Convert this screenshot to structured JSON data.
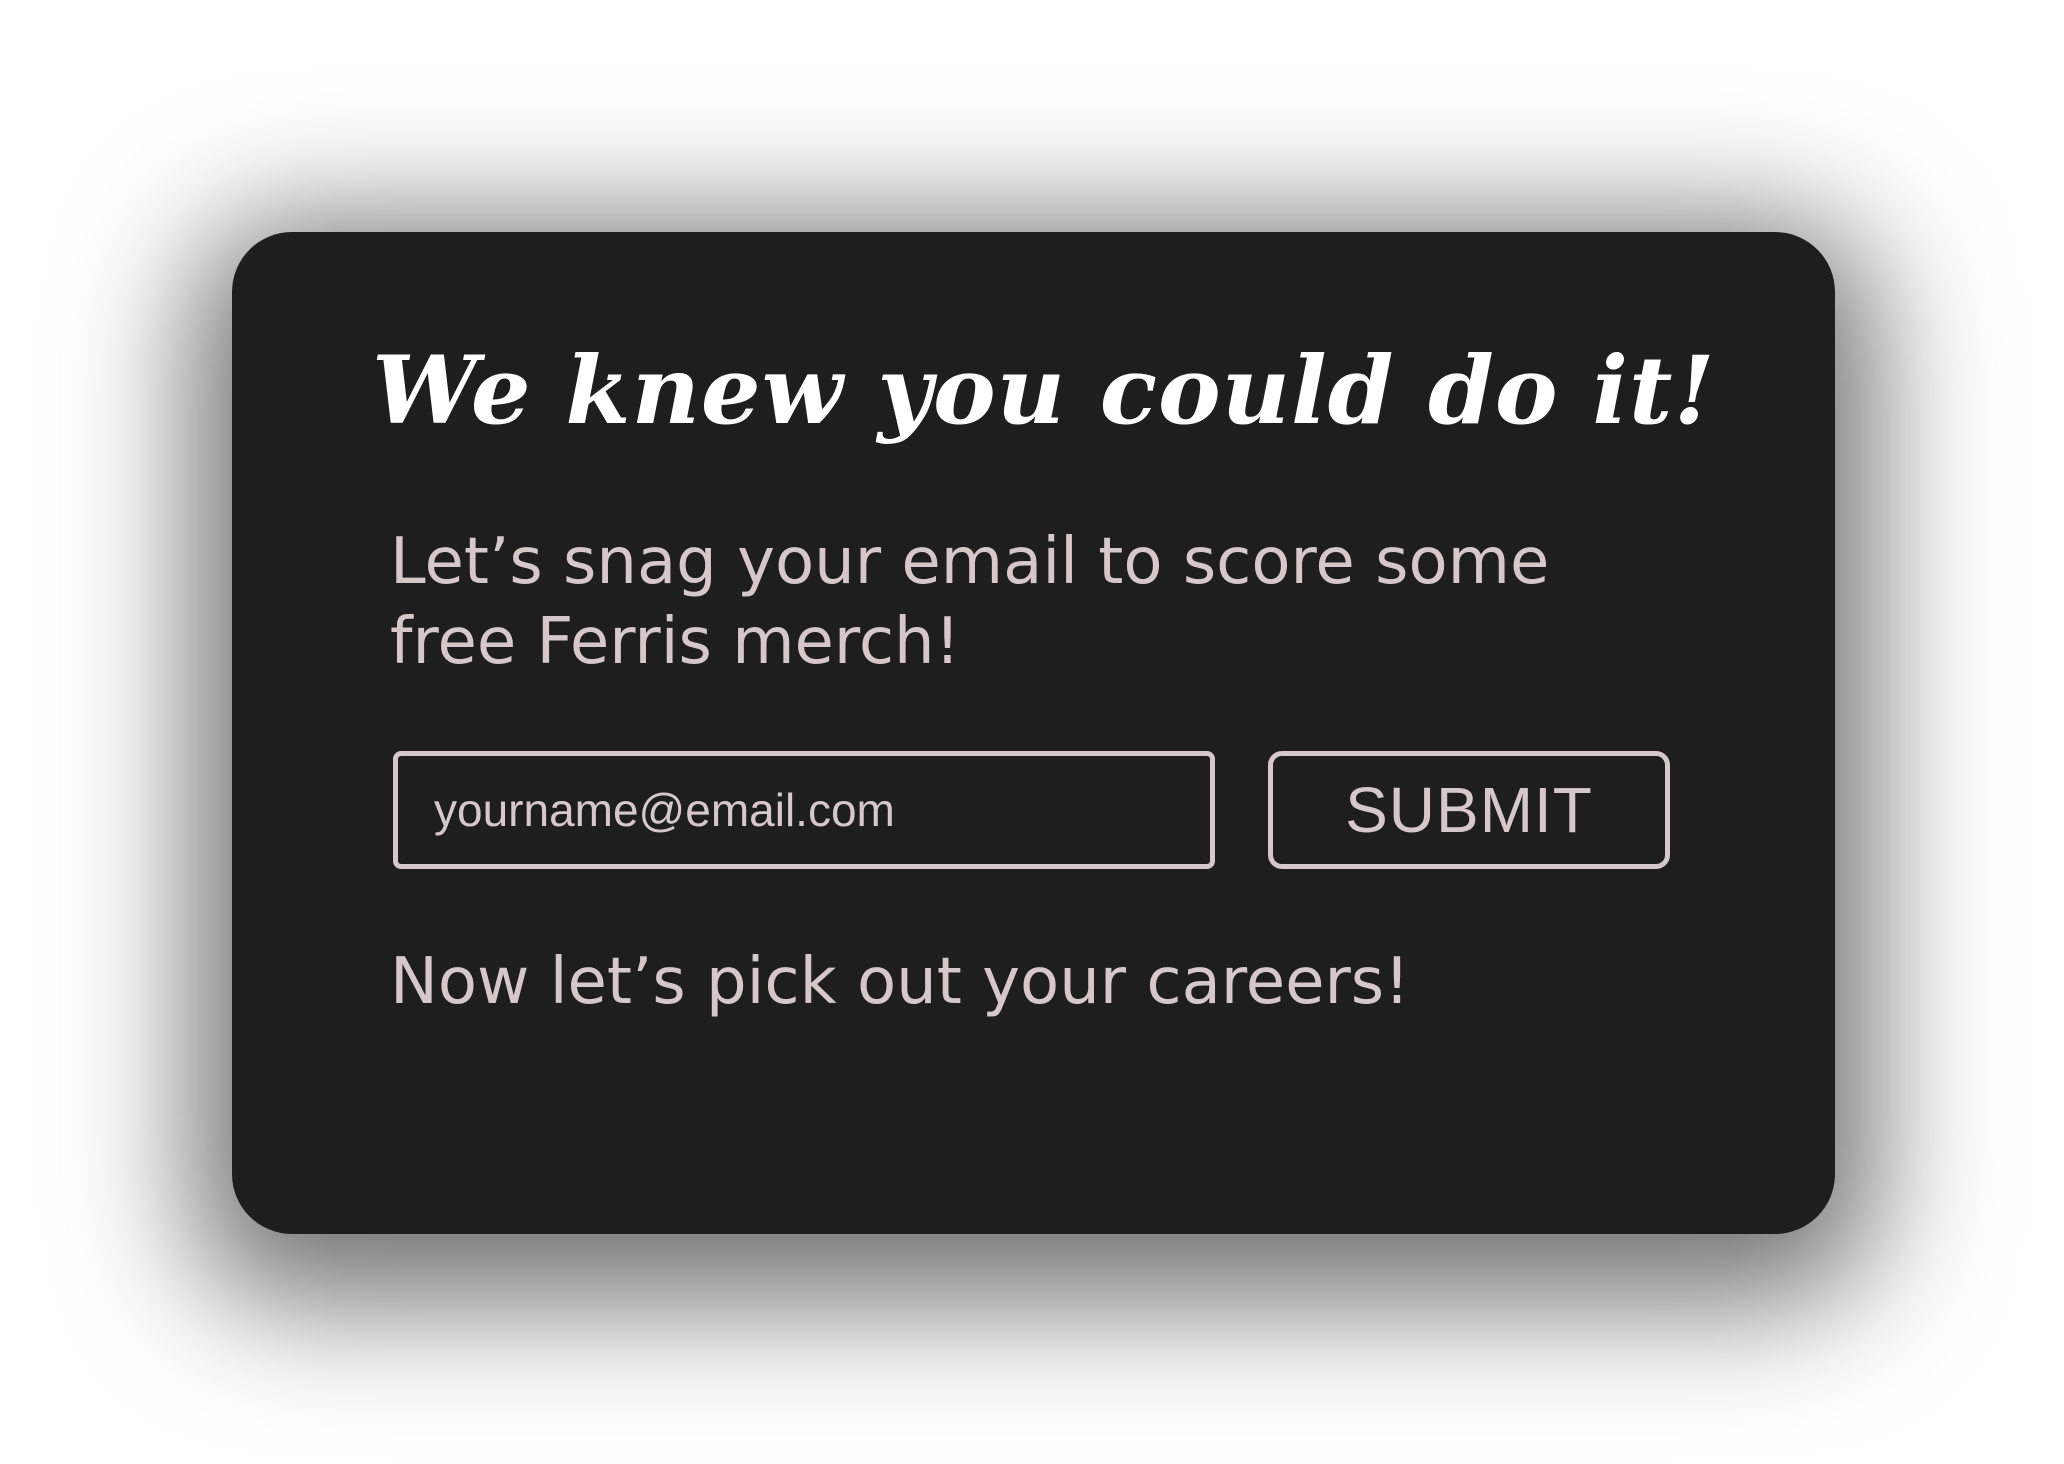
{
  "colors": {
    "page_background": "#ffffff",
    "card_background": "#1e1e1e",
    "headline_text": "#ffffff",
    "body_text": "#d6c7c9"
  },
  "card": {
    "headline": "We knew you could do it!",
    "subtext": "Let’s snag your email to score some free Ferris merch!",
    "email_input": {
      "placeholder": "yourname@email.com",
      "value": ""
    },
    "submit_label": "SUBMIT",
    "careers_text": "Now let’s pick out your careers!"
  }
}
